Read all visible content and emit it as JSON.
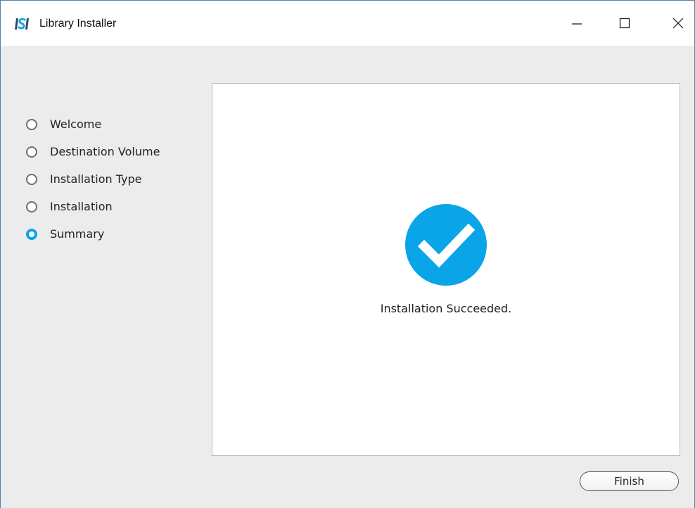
{
  "window": {
    "title": "Library Installer",
    "app_icon": "installer-logo-icon",
    "controls": {
      "minimize_icon": "minimize-icon",
      "maximize_icon": "maximize-icon",
      "close_icon": "close-icon"
    }
  },
  "steps": [
    {
      "label": "Welcome",
      "state": "done"
    },
    {
      "label": "Destination Volume",
      "state": "done"
    },
    {
      "label": "Installation Type",
      "state": "done"
    },
    {
      "label": "Installation",
      "state": "done"
    },
    {
      "label": "Summary",
      "state": "current"
    }
  ],
  "main": {
    "status_icon": "checkmark-circle-icon",
    "status_text": "Installation Succeeded."
  },
  "footer": {
    "finish_label": "Finish"
  },
  "colors": {
    "accent": "#0aa5e9",
    "background": "#ececec",
    "panel": "#ffffff"
  }
}
